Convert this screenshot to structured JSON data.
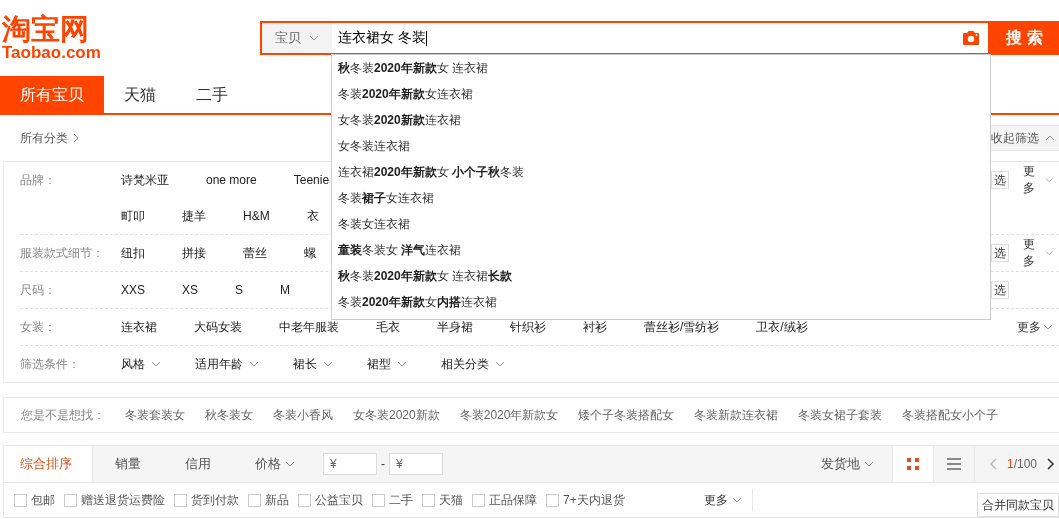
{
  "header": {
    "logo_title": "淘宝网",
    "logo_subtitle": "Taobao.com",
    "search_scope": "宝贝",
    "search_value": "连衣裙女 冬装",
    "search_button": "搜 索"
  },
  "tabs": [
    {
      "label": "所有宝贝",
      "selected": true
    },
    {
      "label": "天猫",
      "selected": false
    },
    {
      "label": "二手",
      "selected": false
    }
  ],
  "breadcrumb": "所有分类",
  "collapse_filter": "收起筛选",
  "filters": [
    {
      "label": "品牌：",
      "lines": [
        [
          "诗梵米亚",
          "one more",
          "Teenie"
        ],
        [
          "町叩",
          "捷羊",
          "H&M",
          "衣"
        ]
      ],
      "multi_select": "选",
      "more": "更多"
    },
    {
      "label": "服装款式细节：",
      "lines": [
        [
          "纽扣",
          "拼接",
          "蕾丝",
          "螺"
        ]
      ],
      "multi_select": "选",
      "more": "更多"
    },
    {
      "label": "尺码：",
      "lines": [
        [
          "XXS",
          "XS",
          "S",
          "M"
        ]
      ],
      "multi_select": "选"
    },
    {
      "label": "女装：",
      "lines": [
        [
          "连衣裙",
          "大码女装",
          "中老年服装",
          "毛衣",
          "半身裙",
          "针织衫",
          "衬衫",
          "蕾丝衫/雪纺衫",
          "卫衣/绒衫"
        ]
      ],
      "more": "更多"
    },
    {
      "label": "筛选条件：",
      "kind": "dropdowns",
      "lines": [
        [
          "风格",
          "适用年龄",
          "裙长",
          "裙型",
          "相关分类"
        ]
      ]
    }
  ],
  "autocomplete": [
    "**秋**冬装**2020年新款**女 连衣裙",
    "冬装**2020年新款**女连衣裙",
    "女冬装**2020新款**连衣裙",
    "女冬装连衣裙",
    "连衣裙**2020年新款**女 **小个子秋**冬装",
    "冬装**裙子**女连衣裙",
    "冬装女连衣裙",
    "**童装**冬装女 **洋气**连衣裙",
    "**秋**冬装**2020年新款**女 连衣裙**长款**",
    "冬装**2020年新款**女**内搭**连衣裙"
  ],
  "related": {
    "label": "您是不是想找：",
    "items": [
      "冬装套装女",
      "秋冬装女",
      "冬装小香风",
      "女冬装2020新款",
      "冬装2020年新款女",
      "矮个子冬装搭配女",
      "冬装新款连衣裙",
      "冬装女裙子套装",
      "冬装搭配女小个子"
    ]
  },
  "sort": {
    "options": [
      {
        "label": "综合排序",
        "selected": true
      },
      {
        "label": "销量",
        "selected": false
      },
      {
        "label": "信用",
        "selected": false
      },
      {
        "label": "价格",
        "selected": false,
        "kind": "dropdown"
      }
    ],
    "price_from": "¥",
    "price_sep": "-",
    "price_to": "¥",
    "location": "发货地",
    "views": [
      {
        "kind": "grid",
        "selected": true
      },
      {
        "kind": "list",
        "selected": false
      }
    ],
    "page_current": "1",
    "page_total": "/100"
  },
  "options": [
    {
      "label": "包邮",
      "checked": false
    },
    {
      "label": "赠送退货运费险",
      "checked": false
    },
    {
      "label": "货到付款",
      "checked": false
    },
    {
      "label": "新品",
      "checked": false
    },
    {
      "label": "公益宝贝",
      "checked": false
    },
    {
      "label": "二手",
      "checked": false
    },
    {
      "label": "天猫",
      "checked": false
    },
    {
      "label": "正品保障",
      "checked": false
    },
    {
      "label": "7+天内退货",
      "checked": false
    }
  ],
  "options_more": "更多",
  "merge_button": "合并同款宝贝"
}
